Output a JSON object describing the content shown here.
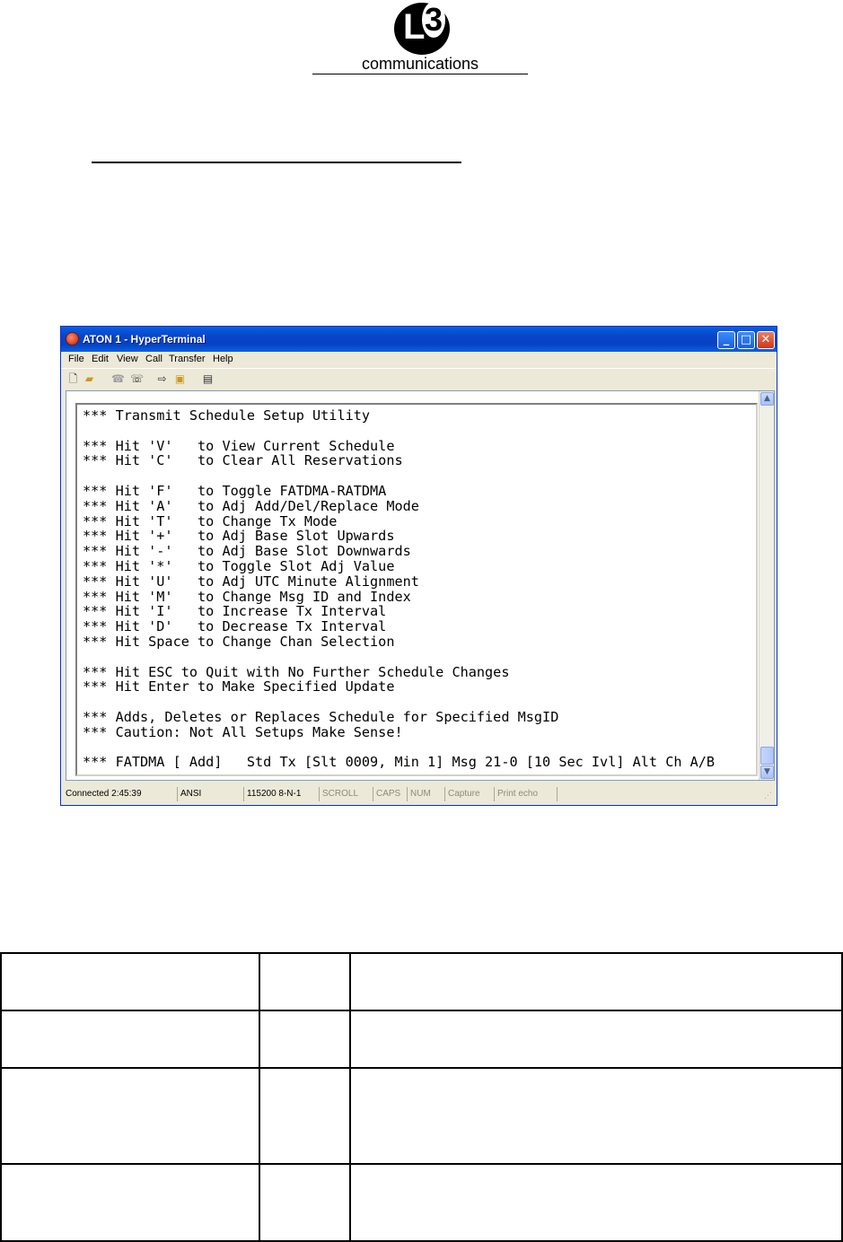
{
  "logo": {
    "mark_l": "L",
    "mark_3": "3",
    "text": "communications"
  },
  "window": {
    "title": "ATON 1 - HyperTerminal",
    "menu": [
      "File",
      "Edit",
      "View",
      "Call",
      "Transfer",
      "Help"
    ],
    "toolbar_icons": [
      "new-icon",
      "open-icon",
      "disconnect-icon",
      "dial-icon",
      "send-icon",
      "receive-icon",
      "properties-icon"
    ],
    "terminal_lines": [
      "*** Transmit Schedule Setup Utility",
      "",
      "*** Hit 'V'   to View Current Schedule",
      "*** Hit 'C'   to Clear All Reservations",
      "",
      "*** Hit 'F'   to Toggle FATDMA-RATDMA",
      "*** Hit 'A'   to Adj Add/Del/Replace Mode",
      "*** Hit 'T'   to Change Tx Mode",
      "*** Hit '+'   to Adj Base Slot Upwards",
      "*** Hit '-'   to Adj Base Slot Downwards",
      "*** Hit '*'   to Toggle Slot Adj Value",
      "*** Hit 'U'   to Adj UTC Minute Alignment",
      "*** Hit 'M'   to Change Msg ID and Index",
      "*** Hit 'I'   to Increase Tx Interval",
      "*** Hit 'D'   to Decrease Tx Interval",
      "*** Hit Space to Change Chan Selection",
      "",
      "*** Hit ESC to Quit with No Further Schedule Changes",
      "*** Hit Enter to Make Specified Update",
      "",
      "*** Adds, Deletes or Replaces Schedule for Specified MsgID",
      "*** Caution: Not All Setups Make Sense!",
      "",
      "*** FATDMA [ Add]   Std Tx [Slt 0009, Min 1] Msg 21-0 [10 Sec Ivl] Alt Ch A/B"
    ],
    "status": {
      "connected": "Connected 2:45:39",
      "emulation": "ANSI",
      "port": "115200 8-N-1",
      "scroll": "SCROLL",
      "caps": "CAPS",
      "num": "NUM",
      "capture": "Capture",
      "print_echo": "Print echo"
    }
  },
  "table": {
    "rows": [
      [
        "",
        "",
        ""
      ],
      [
        "",
        "",
        ""
      ],
      [
        "",
        "",
        ""
      ],
      [
        "",
        "",
        ""
      ]
    ]
  }
}
